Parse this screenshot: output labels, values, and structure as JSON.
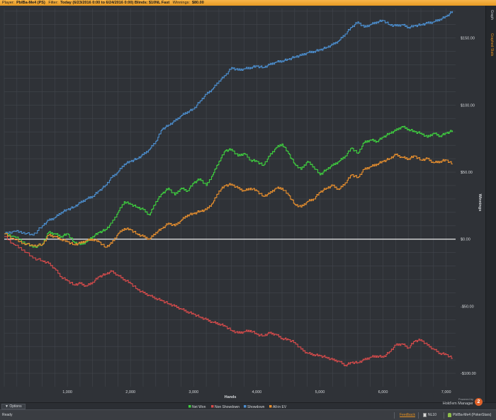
{
  "header": {
    "player_label": "Player:",
    "player_value": "PbIBa-Me4 (PS)",
    "filter_label": "Filter:",
    "filter_value": "Today (6/23/2016 0:00 to 6/24/2016 0:00) Blinds: $10NL Fast",
    "winnings_label": "Winnings:",
    "winnings_value": "$80.00"
  },
  "side_tabs": [
    "Graph",
    "Graphed Stats"
  ],
  "chart_data": {
    "type": "line",
    "xlabel": "Hands",
    "ylabel": "Winnings",
    "xlim": [
      0,
      7150
    ],
    "ylim": [
      -110,
      172
    ],
    "x_ticks": [
      {
        "value": 1000,
        "label": "1,000"
      },
      {
        "value": 2000,
        "label": "2,000"
      },
      {
        "value": 3000,
        "label": "3,000"
      },
      {
        "value": 4000,
        "label": "4,000"
      },
      {
        "value": 5000,
        "label": "5,000"
      },
      {
        "value": 6000,
        "label": "6,000"
      },
      {
        "value": 7000,
        "label": "7,000"
      }
    ],
    "y_ticks": [
      {
        "value": 150,
        "label": "$150.00"
      },
      {
        "value": 100,
        "label": "$100.00"
      },
      {
        "value": 50,
        "label": "$50.00"
      },
      {
        "value": 0,
        "label": "$0.00"
      },
      {
        "value": -50,
        "label": "-$50.00"
      },
      {
        "value": -100,
        "label": "-$100.00"
      }
    ],
    "grid": true,
    "legend_position": "bottom-center",
    "series": [
      {
        "name": "Net Won",
        "color": "#3fd13f",
        "x": [
          0,
          150,
          300,
          450,
          600,
          700,
          800,
          900,
          1000,
          1100,
          1200,
          1300,
          1400,
          1500,
          1600,
          1700,
          1800,
          1900,
          2000,
          2100,
          2200,
          2300,
          2400,
          2500,
          2600,
          2700,
          2800,
          2900,
          3000,
          3100,
          3200,
          3300,
          3400,
          3500,
          3600,
          3700,
          3800,
          3900,
          4000,
          4100,
          4200,
          4300,
          4400,
          4500,
          4600,
          4700,
          4800,
          4900,
          5000,
          5100,
          5200,
          5300,
          5400,
          5500,
          5600,
          5700,
          5800,
          5900,
          6000,
          6100,
          6200,
          6300,
          6400,
          6500,
          6600,
          6700,
          6800,
          6900,
          7000,
          7100
        ],
        "y": [
          4,
          2,
          -2,
          -6,
          -4,
          5,
          4,
          2,
          4,
          -2,
          -4,
          -2,
          2,
          5,
          7,
          12,
          20,
          28,
          26,
          24,
          22,
          18,
          28,
          34,
          38,
          33,
          38,
          36,
          42,
          45,
          40,
          48,
          58,
          66,
          67,
          62,
          64,
          59,
          58,
          55,
          62,
          68,
          71,
          64,
          56,
          52,
          58,
          54,
          48,
          52,
          55,
          58,
          62,
          68,
          64,
          72,
          74,
          73,
          76,
          79,
          81,
          84,
          82,
          80,
          79,
          76,
          79,
          77,
          79,
          81
        ]
      },
      {
        "name": "Non Showdown",
        "color": "#d64b4b",
        "x": [
          0,
          150,
          300,
          450,
          600,
          700,
          800,
          900,
          1000,
          1100,
          1200,
          1300,
          1400,
          1500,
          1600,
          1700,
          1800,
          1900,
          2000,
          2100,
          2200,
          2300,
          2400,
          2500,
          2600,
          2700,
          2800,
          2900,
          3000,
          3100,
          3200,
          3300,
          3400,
          3500,
          3600,
          3700,
          3800,
          3900,
          4000,
          4100,
          4200,
          4300,
          4400,
          4500,
          4600,
          4700,
          4800,
          4900,
          5000,
          5100,
          5200,
          5300,
          5400,
          5500,
          5600,
          5700,
          5800,
          5900,
          6000,
          6100,
          6200,
          6300,
          6400,
          6500,
          6600,
          6700,
          6800,
          6900,
          7000,
          7100
        ],
        "y": [
          2,
          -4,
          -8,
          -14,
          -16,
          -18,
          -22,
          -28,
          -31,
          -34,
          -33,
          -35,
          -32,
          -28,
          -26,
          -24,
          -27,
          -30,
          -33,
          -37,
          -40,
          -42,
          -44,
          -46,
          -48,
          -50,
          -52,
          -54,
          -56,
          -58,
          -60,
          -62,
          -63,
          -65,
          -68,
          -70,
          -69,
          -68,
          -71,
          -72,
          -70,
          -71,
          -74,
          -75,
          -77,
          -82,
          -85,
          -86,
          -87,
          -88,
          -90,
          -91,
          -94,
          -92,
          -92,
          -90,
          -88,
          -87,
          -88,
          -84,
          -79,
          -78,
          -81,
          -76,
          -75,
          -79,
          -82,
          -85,
          -86,
          -89
        ]
      },
      {
        "name": "Showdown",
        "color": "#4c8fd0",
        "x": [
          0,
          150,
          300,
          450,
          600,
          700,
          800,
          900,
          1000,
          1100,
          1200,
          1300,
          1400,
          1500,
          1600,
          1700,
          1800,
          1900,
          2000,
          2100,
          2200,
          2300,
          2400,
          2500,
          2600,
          2700,
          2800,
          2900,
          3000,
          3100,
          3200,
          3300,
          3400,
          3500,
          3600,
          3700,
          3800,
          3900,
          4000,
          4100,
          4200,
          4300,
          4400,
          4500,
          4600,
          4700,
          4800,
          4900,
          5000,
          5100,
          5200,
          5300,
          5400,
          5500,
          5600,
          5700,
          5800,
          5900,
          6000,
          6100,
          6200,
          6300,
          6400,
          6500,
          6600,
          6700,
          6800,
          6900,
          7000,
          7100
        ],
        "y": [
          4,
          6,
          5,
          3,
          10,
          14,
          16,
          20,
          22,
          24,
          27,
          30,
          32,
          36,
          40,
          46,
          50,
          56,
          58,
          60,
          63,
          67,
          73,
          82,
          85,
          88,
          92,
          95,
          97,
          103,
          108,
          112,
          118,
          122,
          128,
          126,
          127,
          128,
          129,
          128,
          130,
          132,
          133,
          134,
          136,
          137,
          139,
          140,
          141,
          143,
          145,
          148,
          153,
          158,
          162,
          158,
          160,
          162,
          163,
          160,
          159,
          160,
          158,
          159,
          160,
          161,
          162,
          164,
          166,
          170
        ]
      },
      {
        "name": "All-in EV",
        "color": "#e88f2e",
        "x": [
          0,
          150,
          300,
          450,
          600,
          700,
          800,
          900,
          1000,
          1100,
          1200,
          1300,
          1400,
          1500,
          1600,
          1700,
          1800,
          1900,
          2000,
          2100,
          2200,
          2300,
          2400,
          2500,
          2600,
          2700,
          2800,
          2900,
          3000,
          3100,
          3200,
          3300,
          3400,
          3500,
          3600,
          3700,
          3800,
          3900,
          4000,
          4100,
          4200,
          4300,
          4400,
          4500,
          4600,
          4700,
          4800,
          4900,
          5000,
          5100,
          5200,
          5300,
          5400,
          5500,
          5600,
          5700,
          5800,
          5900,
          6000,
          6100,
          6200,
          6300,
          6400,
          6500,
          6600,
          6700,
          6800,
          6900,
          7000,
          7100
        ],
        "y": [
          4,
          0,
          -3,
          -5,
          -4,
          3,
          2,
          0,
          -2,
          -4,
          -3,
          -1,
          0,
          -2,
          -6,
          -3,
          4,
          8,
          7,
          4,
          2,
          0,
          5,
          8,
          12,
          10,
          14,
          18,
          19,
          21,
          22,
          27,
          36,
          40,
          41,
          38,
          36,
          38,
          36,
          32,
          34,
          38,
          38,
          33,
          26,
          24,
          28,
          30,
          35,
          38,
          40,
          37,
          42,
          48,
          46,
          52,
          54,
          56,
          58,
          60,
          63,
          61,
          60,
          62,
          59,
          60,
          57,
          58,
          59,
          56
        ]
      }
    ]
  },
  "options_label": "Options",
  "status": {
    "ready_text": "Ready",
    "feedback_label": "Feedback",
    "stakes_label": "NL10",
    "account_label": "PbIBa-Me4 (PokerStars)"
  },
  "brand": {
    "powered_by": "Powered by",
    "name": "Hold'em Manager",
    "version_badge": "2"
  },
  "colors": {
    "accent": "#e8911f",
    "background": "#2f3237",
    "grid": "#42464c",
    "zero_line": "#ffffff"
  }
}
